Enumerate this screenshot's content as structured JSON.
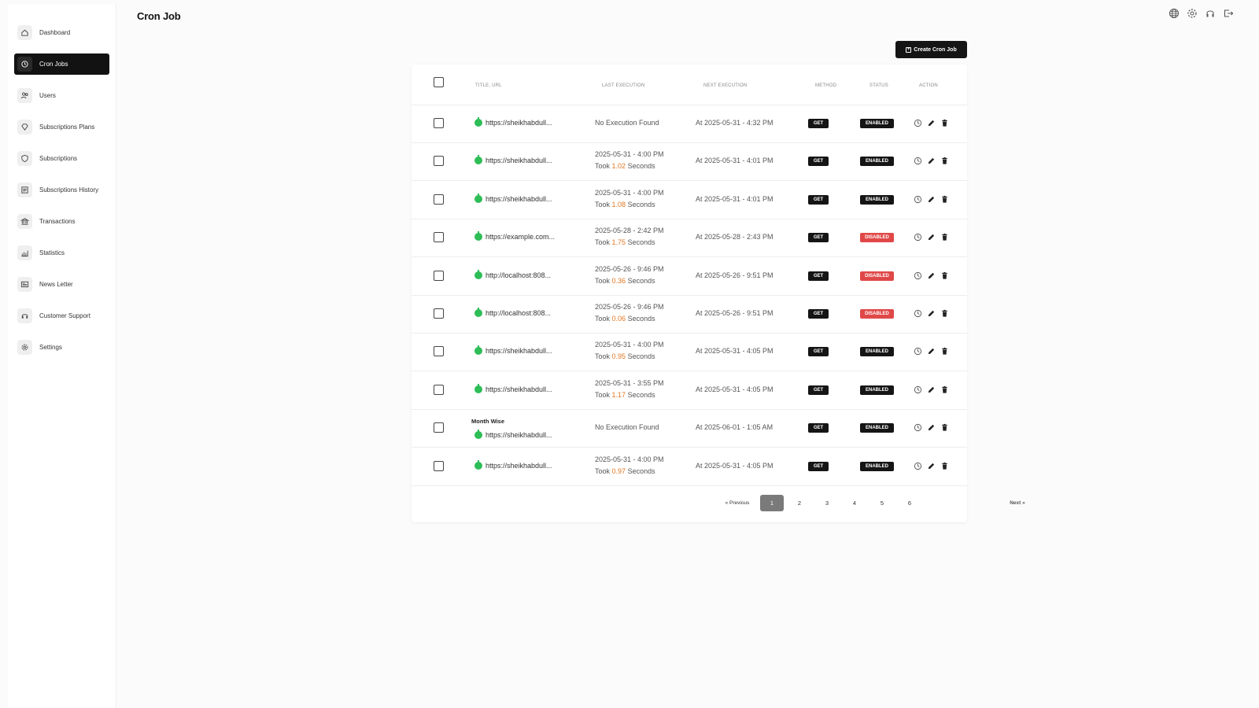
{
  "page": {
    "title": "Cron Job"
  },
  "sidebar": {
    "items": [
      {
        "label": "Dashboard",
        "icon": "home-icon"
      },
      {
        "label": "Cron Jobs",
        "icon": "clock-icon",
        "active": true
      },
      {
        "label": "Users",
        "icon": "users-icon"
      },
      {
        "label": "Subscriptions Plans",
        "icon": "diamond-icon"
      },
      {
        "label": "Subscriptions",
        "icon": "shield-icon"
      },
      {
        "label": "Subscriptions History",
        "icon": "list-icon"
      },
      {
        "label": "Transactions",
        "icon": "bank-icon"
      },
      {
        "label": "Statistics",
        "icon": "bar-chart-icon"
      },
      {
        "label": "News Letter",
        "icon": "newspaper-icon"
      },
      {
        "label": "Customer Support",
        "icon": "headset-icon"
      },
      {
        "label": "Settings",
        "icon": "gear-icon"
      }
    ]
  },
  "topbar": {
    "icons": [
      "globe-icon",
      "gear-icon",
      "headset-icon",
      "logout-icon"
    ]
  },
  "toolbar": {
    "create_label": "Create Cron Job"
  },
  "table": {
    "headers": {
      "title_url": "TITLE, URL",
      "last_execution": "LAST EXECUTION",
      "next_execution": "NEXT EXECUTION",
      "method": "METHOD",
      "status": "STATUS",
      "action": "ACTION"
    },
    "rows": [
      {
        "title": "",
        "url": "https://sheikhabdull...",
        "last_exec": "No Execution Found",
        "took_prefix": "",
        "took_value": "",
        "took_suffix": "",
        "next_exec": "At 2025-05-31 - 4:32 PM",
        "method": "GET",
        "status": "ENABLED"
      },
      {
        "title": "",
        "url": "https://sheikhabdull...",
        "last_exec": "2025-05-31 - 4:00 PM",
        "took_prefix": "Took",
        "took_value": "1.02",
        "took_suffix": "Seconds",
        "next_exec": "At 2025-05-31 - 4:01 PM",
        "method": "GET",
        "status": "ENABLED"
      },
      {
        "title": "",
        "url": "https://sheikhabdull...",
        "last_exec": "2025-05-31 - 4:00 PM",
        "took_prefix": "Took",
        "took_value": "1.08",
        "took_suffix": "Seconds",
        "next_exec": "At 2025-05-31 - 4:01 PM",
        "method": "GET",
        "status": "ENABLED"
      },
      {
        "title": "",
        "url": "https://example.com...",
        "last_exec": "2025-05-28 - 2:42 PM",
        "took_prefix": "Took",
        "took_value": "1.75",
        "took_suffix": "Seconds",
        "next_exec": "At 2025-05-28 - 2:43 PM",
        "method": "GET",
        "status": "DISABLED"
      },
      {
        "title": "",
        "url": "http://localhost:808...",
        "last_exec": "2025-05-26 - 9:46 PM",
        "took_prefix": "Took",
        "took_value": "0.36",
        "took_suffix": "Seconds",
        "next_exec": "At 2025-05-26 - 9:51 PM",
        "method": "GET",
        "status": "DISABLED"
      },
      {
        "title": "",
        "url": "http://localhost:808...",
        "last_exec": "2025-05-26 - 9:46 PM",
        "took_prefix": "Took",
        "took_value": "0.06",
        "took_suffix": "Seconds",
        "next_exec": "At 2025-05-26 - 9:51 PM",
        "method": "GET",
        "status": "DISABLED"
      },
      {
        "title": "",
        "url": "https://sheikhabdull...",
        "last_exec": "2025-05-31 - 4:00 PM",
        "took_prefix": "Took",
        "took_value": "0.95",
        "took_suffix": "Seconds",
        "next_exec": "At 2025-05-31 - 4:05 PM",
        "method": "GET",
        "status": "ENABLED"
      },
      {
        "title": "",
        "url": "https://sheikhabdull...",
        "last_exec": "2025-05-31 - 3:55 PM",
        "took_prefix": "Took",
        "took_value": "1.17",
        "took_suffix": "Seconds",
        "next_exec": "At 2025-05-31 - 4:05 PM",
        "method": "GET",
        "status": "ENABLED"
      },
      {
        "title": "Month Wise",
        "url": "https://sheikhabdull...",
        "last_exec": "No Execution Found",
        "took_prefix": "",
        "took_value": "",
        "took_suffix": "",
        "next_exec": "At 2025-06-01 - 1:05 AM",
        "method": "GET",
        "status": "ENABLED"
      },
      {
        "title": "",
        "url": "https://sheikhabdull...",
        "last_exec": "2025-05-31 - 4:00 PM",
        "took_prefix": "Took",
        "took_value": "0.97",
        "took_suffix": "Seconds",
        "next_exec": "At 2025-05-31 - 4:05 PM",
        "method": "GET",
        "status": "ENABLED"
      }
    ]
  },
  "pagination": {
    "prev_label": "« Previous",
    "next_label": "Next »",
    "pages": [
      "1",
      "2",
      "3",
      "4",
      "5",
      "6"
    ],
    "current": "1"
  },
  "colors": {
    "accent": "#151515",
    "enabled": "#151515",
    "disabled": "#e04848",
    "success_dot": "#2ebd57",
    "took_value": "#e57722"
  }
}
